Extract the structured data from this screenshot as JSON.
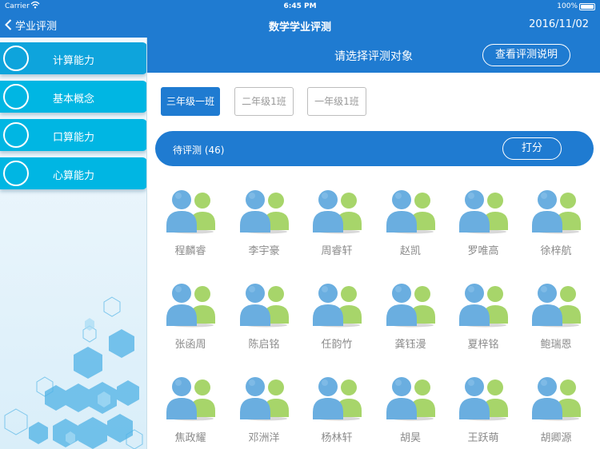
{
  "status": {
    "carrier": "Carrier",
    "time": "6:45 PM",
    "battery": "100%"
  },
  "nav": {
    "back_label": "学业评测",
    "title": "数学学业评测",
    "date": "2016/11/02"
  },
  "sidebar": {
    "items": [
      {
        "label": "计算能力",
        "active": true
      },
      {
        "label": "基本概念",
        "active": false
      },
      {
        "label": "口算能力",
        "active": false
      },
      {
        "label": "心算能力",
        "active": false
      }
    ]
  },
  "main": {
    "title": "请选择评测对象",
    "guide_button": "查看评测说明",
    "classes": [
      {
        "label": "三年级一班",
        "selected": true
      },
      {
        "label": "二年级1班",
        "selected": false
      },
      {
        "label": "一年级1班",
        "selected": false
      }
    ],
    "pending_label": "待评测 (46)",
    "score_button": "打分",
    "students": [
      "程麟睿",
      "李宇豪",
      "周睿轩",
      "赵凯",
      "罗唯高",
      "徐梓航",
      "张函周",
      "陈启铭",
      "任韵竹",
      "龚钰漫",
      "夏梓铭",
      "鲍瑞恩",
      "焦政耀",
      "邓洲洋",
      "杨林轩",
      "胡昊",
      "王跃萌",
      "胡卿源"
    ]
  },
  "colors": {
    "primary": "#1f7bd1",
    "sidebar_item": "#00b6e3",
    "avatar_blue": "#6aaee0",
    "avatar_green": "#a7d56a"
  }
}
